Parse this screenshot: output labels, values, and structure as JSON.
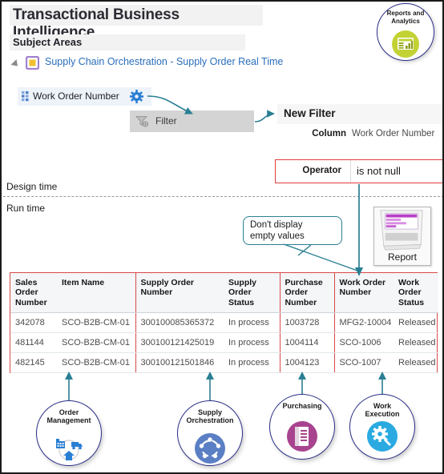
{
  "page": {
    "title": "Transactional Business Intelligence",
    "subject_areas_label": "Subject Areas",
    "subject_area_link": "Supply Chain Orchestration - Supply Order Real Time",
    "design_time_label": "Design time",
    "run_time_label": "Run time"
  },
  "top_badge": {
    "line1": "Reports and",
    "line2": "Analytics",
    "icon": "report-chart-icon",
    "icon_color": "#c2d234",
    "ring_color": "#2a2f86"
  },
  "column_field": {
    "label": "Work Order Number",
    "grip_icon": "column-grip-icon",
    "gear_icon": "gear-icon",
    "gear_color": "#2a7fd4"
  },
  "context_menu": {
    "item_label": "Filter",
    "icon": "filter-funnel-icon"
  },
  "new_filter": {
    "heading": "New Filter",
    "column_label": "Column",
    "column_value": "Work Order Number",
    "operator_label": "Operator",
    "operator_value": "is not null",
    "highlight_color": "#e13c3c"
  },
  "callout": {
    "line1": "Don't display",
    "line2": "empty values",
    "border_color": "#2a7f93"
  },
  "report_icon": {
    "caption": "Report",
    "icon": "report-document-icon"
  },
  "table": {
    "headers": [
      "Sales Order Number",
      "Item Name",
      "Supply Order Number",
      "Supply Order Status",
      "Purchase Order Number",
      "Work Order Number",
      "Work Order Status"
    ],
    "rows": [
      [
        "342078",
        "SCO-B2B-CM-01",
        "300100085365372",
        "In process",
        "1003728",
        "MFG2-10004",
        "Released"
      ],
      [
        "481144",
        "SCO-B2B-CM-01",
        "300100121425019",
        "In process",
        "1004114",
        "SCO-1006",
        "Released"
      ],
      [
        "482145",
        "SCO-B2B-CM-01",
        "300100121501846",
        "In process",
        "1004123",
        "SCO-1007",
        "Released"
      ]
    ],
    "border_color": "#d94a4a"
  },
  "badges": [
    {
      "line1": "Order",
      "line2": "Management",
      "icon": "factory-truck-home-icon",
      "icon_color": "#ffffff"
    },
    {
      "line1": "Supply",
      "line2": "Orchestration",
      "icon": "orchestration-dots-icon",
      "icon_color": "#5a7fc4"
    },
    {
      "line1": "Purchasing",
      "line2": "",
      "icon": "purchase-doc-icon",
      "icon_color": "#a8448f"
    },
    {
      "line1": "Work",
      "line2": "Execution",
      "icon": "gear-wrench-icon",
      "icon_color": "#2aaae1"
    }
  ],
  "connector_color": "#2a7f93"
}
